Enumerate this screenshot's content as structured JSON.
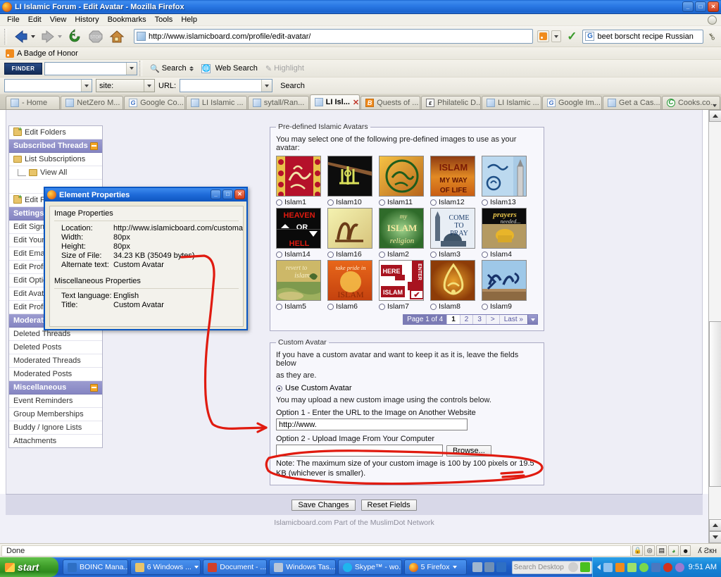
{
  "window": {
    "title": "LI Islamic Forum - Edit Avatar - Mozilla Firefox",
    "minimize": "_",
    "maximize": "□",
    "close": "✕"
  },
  "menubar": {
    "items": [
      "File",
      "Edit",
      "View",
      "History",
      "Bookmarks",
      "Tools",
      "Help"
    ]
  },
  "navbar": {
    "back": "back-arrow",
    "forward": "forward-arrow",
    "reload": "reload-arrow",
    "stop": "STOP",
    "home": "home-icon",
    "url": "http://www.islamicboard.com/profile/edit-avatar/",
    "search_value": "beet borscht recipe Russian"
  },
  "bookmarks": {
    "items": [
      "A Badge of Honor"
    ]
  },
  "finder_toolbar": {
    "logo": "FINDER",
    "query": "",
    "search_label": "Search",
    "web_search_label": "Web Search",
    "highlight_label": "Highlight",
    "second_row": {
      "keyword": "",
      "site_label": "site:",
      "url_label": "URL:",
      "url_value": "",
      "search_button": "Search"
    }
  },
  "tabs": [
    {
      "label": "- Home",
      "icon": "page-icon",
      "active": false
    },
    {
      "label": "NetZero M...",
      "icon": "page-icon",
      "active": false
    },
    {
      "label": "Google Co...",
      "icon": "google-icon",
      "active": false
    },
    {
      "label": "LI Islamic ...",
      "icon": "page-icon",
      "active": false
    },
    {
      "label": "sytall/Ran...",
      "icon": "page-icon",
      "active": false
    },
    {
      "label": "LI Isl...",
      "icon": "page-icon",
      "active": true
    },
    {
      "label": "Quests of ...",
      "icon": "blogger-icon",
      "active": false
    },
    {
      "label": "Philatelic D...",
      "icon": "dark-icon",
      "active": false
    },
    {
      "label": "LI Islamic ...",
      "icon": "page-icon",
      "active": false
    },
    {
      "label": "Google Im...",
      "icon": "google-icon",
      "active": false
    },
    {
      "label": "Get a Cas...",
      "icon": "page-icon",
      "active": false
    },
    {
      "label": "Cooks.co...",
      "icon": "green-c-icon",
      "active": false
    }
  ],
  "sidebar": {
    "items": [
      {
        "label": "Edit Folders",
        "type": "link",
        "icon": "folder-plus-icon"
      },
      {
        "label": "Subscribed Threads",
        "type": "header",
        "icon": "collapse-icon"
      },
      {
        "label": "List Subscriptions",
        "type": "link",
        "icon": "folder-icon"
      },
      {
        "label": "View All",
        "type": "sublink",
        "icon": "folder-icon"
      },
      {
        "label": "Edit F",
        "type": "link",
        "icon": "folder-plus-icon"
      },
      {
        "label": "Settings &",
        "type": "header",
        "icon": "collapse-icon"
      },
      {
        "label": "Edit Sign",
        "type": "link",
        "icon": ""
      },
      {
        "label": "Edit Your",
        "type": "link",
        "icon": ""
      },
      {
        "label": "Edit Ema",
        "type": "link",
        "icon": ""
      },
      {
        "label": "Edit Profi",
        "type": "link",
        "icon": ""
      },
      {
        "label": "Edit Optio",
        "type": "link",
        "icon": ""
      },
      {
        "label": "Edit Avat",
        "type": "link",
        "icon": ""
      },
      {
        "label": "Edit Profi",
        "type": "link",
        "icon": ""
      },
      {
        "label": "Moderation",
        "type": "header",
        "icon": "collapse-icon"
      },
      {
        "label": "Deleted Threads",
        "type": "link",
        "icon": ""
      },
      {
        "label": "Deleted Posts",
        "type": "link",
        "icon": ""
      },
      {
        "label": "Moderated Threads",
        "type": "link",
        "icon": ""
      },
      {
        "label": "Moderated Posts",
        "type": "link",
        "icon": ""
      },
      {
        "label": "Miscellaneous",
        "type": "header",
        "icon": "collapse-icon"
      },
      {
        "label": "Event Reminders",
        "type": "link",
        "icon": ""
      },
      {
        "label": "Group Memberships",
        "type": "link",
        "icon": ""
      },
      {
        "label": "Buddy / Ignore Lists",
        "type": "link",
        "icon": ""
      },
      {
        "label": "Attachments",
        "type": "link",
        "icon": ""
      }
    ]
  },
  "predefined": {
    "legend": "Pre-defined Islamic Avatars",
    "intro": "You may select one of the following pre-defined images to use as your avatar:",
    "rows": [
      [
        {
          "label": "Islam1",
          "selected": false,
          "art": "islam1"
        },
        {
          "label": "Islam10",
          "selected": false,
          "art": "islam10"
        },
        {
          "label": "Islam11",
          "selected": false,
          "art": "islam11"
        },
        {
          "label": "Islam12",
          "selected": false,
          "art": "islam12"
        },
        {
          "label": "Islam13",
          "selected": false,
          "art": "islam13"
        }
      ],
      [
        {
          "label": "Islam14",
          "selected": false,
          "art": "islam14"
        },
        {
          "label": "Islam16",
          "selected": false,
          "art": "islam16"
        },
        {
          "label": "Islam2",
          "selected": false,
          "art": "islam2"
        },
        {
          "label": "Islam3",
          "selected": false,
          "art": "islam3"
        },
        {
          "label": "Islam4",
          "selected": false,
          "art": "islam4"
        }
      ],
      [
        {
          "label": "Islam5",
          "selected": false,
          "art": "islam5"
        },
        {
          "label": "Islam6",
          "selected": false,
          "art": "islam6"
        },
        {
          "label": "Islam7",
          "selected": false,
          "art": "islam7"
        },
        {
          "label": "Islam8",
          "selected": false,
          "art": "islam8"
        },
        {
          "label": "Islam9",
          "selected": false,
          "art": "islam9"
        }
      ]
    ],
    "art_text": {
      "islam12_l1": "ISLAM",
      "islam12_l2": "MY WAY",
      "islam12_l3": "OF LIFE",
      "islam14_l1": "HEAVEN",
      "islam14_l2": "OR",
      "islam14_l3": "HELL",
      "islam2_l1": "my",
      "islam2_l2": "ISLAM",
      "islam2_l3": "religion",
      "islam3_l1": "COME",
      "islam3_l2": "TO",
      "islam3_l3": "PRAY",
      "islam4_l1": "prayers",
      "islam4_l2": "needed...",
      "islam5_l1": "revert to",
      "islam5_l2": "islam",
      "islam6_l1": "take pride in",
      "islam6_l2": "ISLAM",
      "islam7_l1": "HERE",
      "islam7_l2": "ENTER",
      "islam7_l3": "ISLAM",
      "islam7_l4": "✔"
    },
    "pager": {
      "label": "Page 1 of 4",
      "pages": [
        "1",
        "2",
        "3"
      ],
      "current": "1",
      "next": ">",
      "last": "Last »",
      "dropdown": "▼"
    }
  },
  "custom_avatar": {
    "legend": "Custom Avatar",
    "intro_line1": "If you have a custom avatar and want to keep it as it is, leave the fields below",
    "intro_line2": "as they are.",
    "use_custom_label": "Use Custom Avatar",
    "use_custom_selected": true,
    "upload_hint": "You may upload a new custom image using the controls below.",
    "option1_label": "Option 1 - Enter the URL to the Image on Another Website",
    "option1_value": "http://www.",
    "option2_label": "Option 2 - Upload Image From Your Computer",
    "option2_value": "",
    "browse_button": "Browse...",
    "note_line1": "Note: The maximum size of your custom image is 100 by 100 pixels or 19.5",
    "note_line2": "KB (whichever is smaller)."
  },
  "form_actions": {
    "save": "Save Changes",
    "reset": "Reset Fields"
  },
  "page_footer": {
    "line1": "Islamicboard.com Part of the MuslimDot Network"
  },
  "dialog": {
    "title": "Element Properties",
    "section1": "Image Properties",
    "section2": "Miscellaneous Properties",
    "rows1": [
      {
        "key": "Location:",
        "value": "http://www.islamicboard.com/customavatars/a"
      },
      {
        "key": "Width:",
        "value": "80px"
      },
      {
        "key": "Height:",
        "value": "80px"
      },
      {
        "key": "Size of File:",
        "value": "34.23 KB (35049 bytes)"
      },
      {
        "key": "Alternate text:",
        "value": "Custom Avatar"
      }
    ],
    "rows2": [
      {
        "key": "Text language:",
        "value": "English"
      },
      {
        "key": "Title:",
        "value": "Custom Avatar"
      }
    ],
    "minimize": "_",
    "maximize": "□",
    "close": "✕"
  },
  "statusbar": {
    "text": "Done",
    "skin_label": "ʎ Ƨкн"
  },
  "taskbar": {
    "start": "start",
    "buttons": [
      {
        "label": "BOINC Mana...",
        "icon": "boinc-icon"
      },
      {
        "label": "6 Windows ...",
        "icon": "folder-icon",
        "group": true
      },
      {
        "label": "Document - ...",
        "icon": "document-icon"
      },
      {
        "label": "Windows Tas...",
        "icon": "monitor-icon"
      },
      {
        "label": "Skype™ - wo...",
        "icon": "skype-icon"
      },
      {
        "label": "5 Firefox",
        "icon": "firefox-icon",
        "group": true
      }
    ],
    "desktop_search_placeholder": "Search Desktop",
    "clock": "9:51 AM"
  },
  "colors": {
    "titlebar_blue": "#1e6ad8",
    "taskbar_blue": "#1e5fc8",
    "start_green": "#3f9e2a",
    "annotation_red": "#e01b10",
    "nav_header_purple": "#8585c2",
    "collapse_orange": "#f5a623"
  }
}
